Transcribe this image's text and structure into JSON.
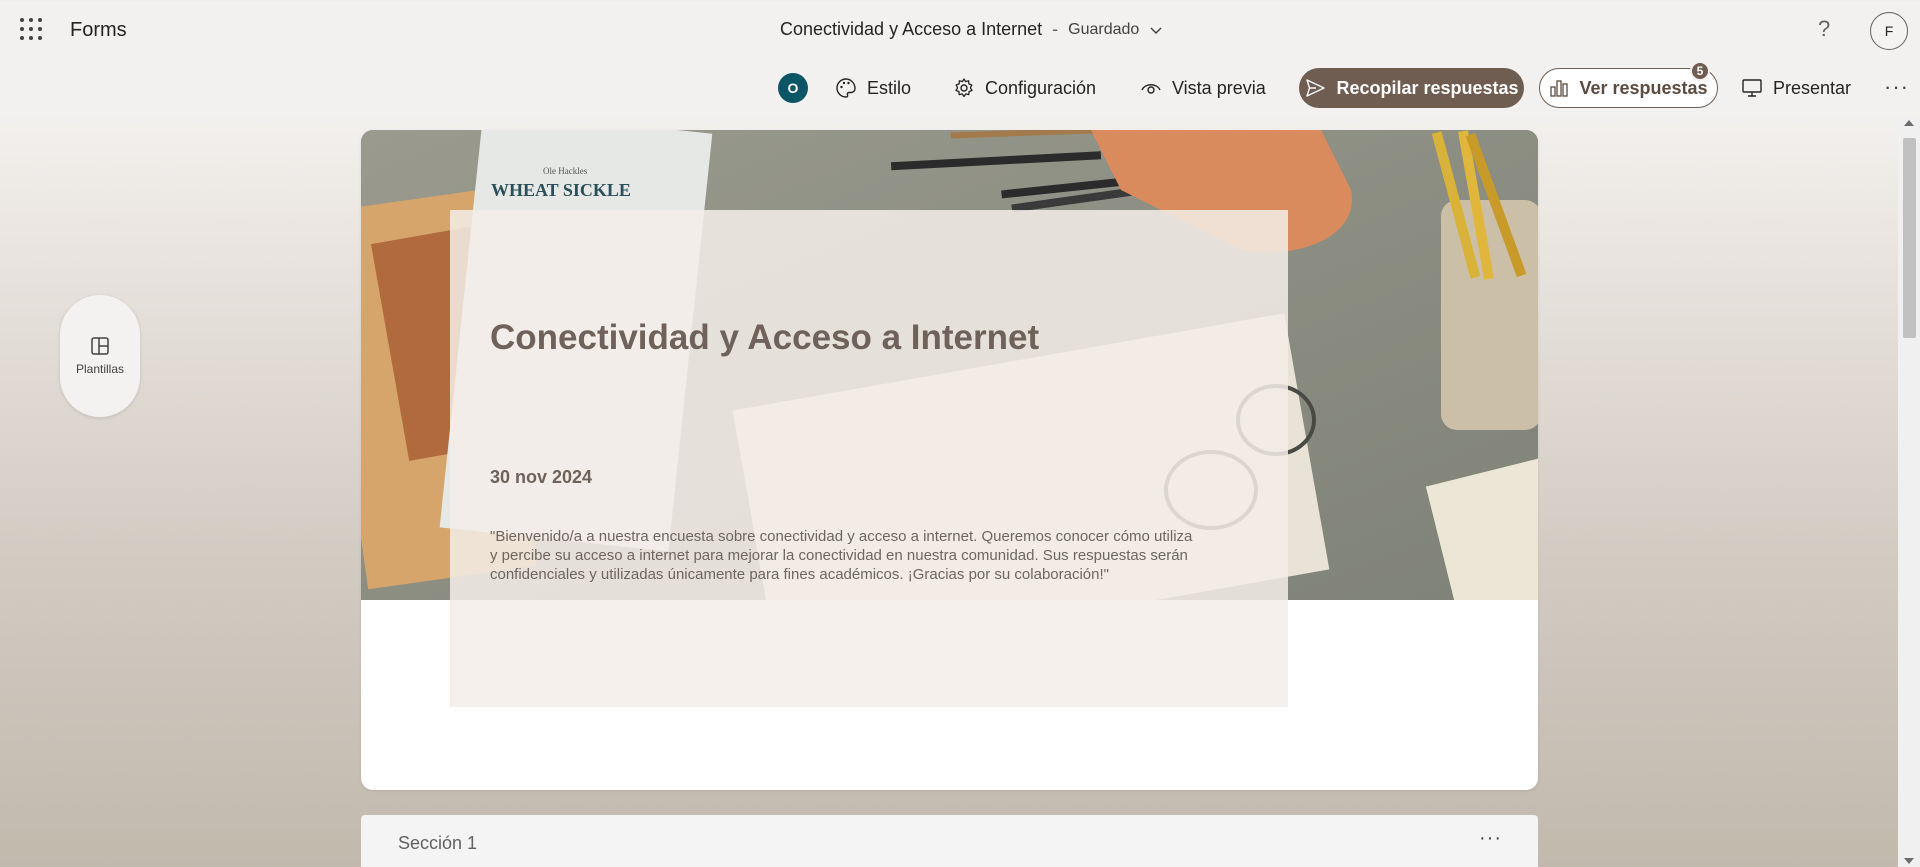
{
  "app": {
    "name": "Forms"
  },
  "header": {
    "doc_title": "Conectividad y Acceso a Internet",
    "separator": "-",
    "save_status": "Guardado",
    "help_label": "?",
    "user_initial": "F"
  },
  "toolbar": {
    "owner_initial": "O",
    "style_label": "Estilo",
    "settings_label": "Configuración",
    "preview_label": "Vista previa",
    "collect_label": "Recopilar respuestas",
    "responses_label": "Ver respuestas",
    "responses_count": "5",
    "present_label": "Presentar"
  },
  "side": {
    "templates_label": "Plantillas"
  },
  "form": {
    "title": "Conectividad y Acceso a Internet",
    "date": "30 nov 2024",
    "description": "\"Bienvenido/a a nuestra encuesta sobre conectividad y acceso a internet. Queremos conocer cómo utiliza y percibe su acceso a internet para mejorar la conectividad en nuestra comunidad. Sus res­puestas serán confidenciales y utilizadas únicamente para fines académicos. ¡Gracias por su colaboración!\"",
    "banner_book_title": "WHEAT SICKLE",
    "banner_book_author": "Ole Hackles"
  },
  "section": {
    "title": "Sección 1"
  },
  "colors": {
    "accent": "#6e5d50",
    "owner_avatar": "#0b5566",
    "title_text": "#6e625a"
  },
  "icons": {
    "apps": "waffle-icon",
    "style": "palette-icon",
    "settings": "gear-icon",
    "preview": "eye-icon",
    "collect": "send-icon",
    "responses": "chart-icon",
    "present": "monitor-icon",
    "templates": "layout-icon"
  }
}
